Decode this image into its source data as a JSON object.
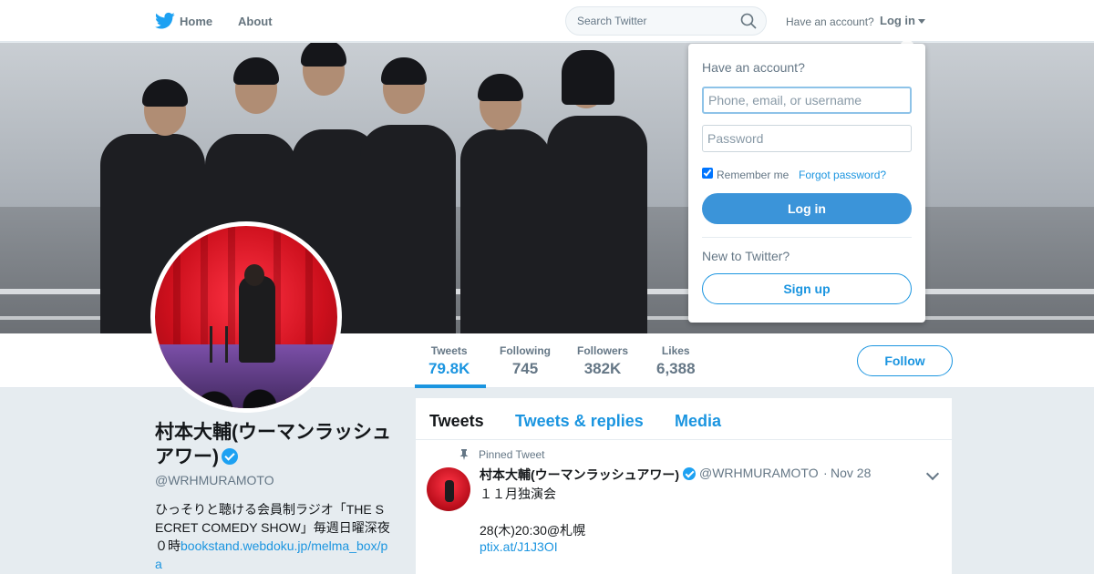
{
  "topbar": {
    "home_label": "Home",
    "about_label": "About",
    "search_placeholder": "Search Twitter",
    "have_account": "Have an account?",
    "login_label": "Log in"
  },
  "profile": {
    "name": "村本大輔(ウーマンラッシュアワー)",
    "handle": "@WRHMURAMOTO",
    "bio_text": "ひっそりと聴ける会員制ラジオ「THE SECRET COMEDY SHOW」毎週日曜深夜０時",
    "bio_link": "bookstand.webdoku.jp/melma_box/pa"
  },
  "stats": [
    {
      "label": "Tweets",
      "value": "79.8K"
    },
    {
      "label": "Following",
      "value": "745"
    },
    {
      "label": "Followers",
      "value": "382K"
    },
    {
      "label": "Likes",
      "value": "6,388"
    }
  ],
  "follow_label": "Follow",
  "timeline": {
    "tabs": [
      "Tweets",
      "Tweets & replies",
      "Media"
    ],
    "pinned_label": "Pinned Tweet",
    "tweet": {
      "name": "村本大輔(ウーマンラッシュアワー)",
      "handle": "@WRHMURAMOTO",
      "separator": "·",
      "time": "Nov 28",
      "line1": "１１月独演会",
      "line2": "28(木)20:30@札幌",
      "link": "ptix.at/J1J3OI"
    }
  },
  "login_dropdown": {
    "heading": "Have an account?",
    "username_placeholder": "Phone, email, or username",
    "password_placeholder": "Password",
    "remember_label": "Remember me",
    "separator": "·",
    "forgot_label": "Forgot password?",
    "login_button": "Log in",
    "new_label": "New to Twitter?",
    "signup_button": "Sign up"
  },
  "colors": {
    "accent": "#1b95e0",
    "login_button": "#3b94d9",
    "background": "#e6ecf0"
  }
}
